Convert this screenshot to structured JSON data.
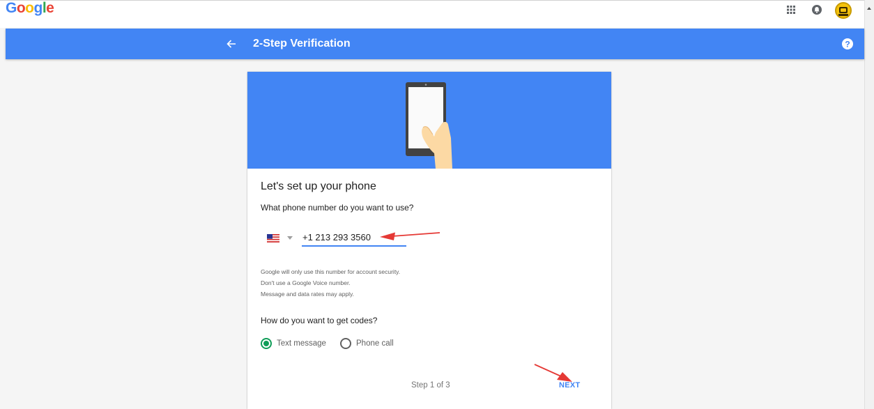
{
  "topbar": {
    "logo_letters": [
      "G",
      "o",
      "o",
      "g",
      "l",
      "e"
    ]
  },
  "header": {
    "title": "2-Step Verification"
  },
  "card": {
    "title": "Let's set up your phone",
    "phone_question": "What phone number do you want to use?",
    "phone_value": "+1 213 293 3560",
    "country": "US",
    "fine_print": [
      "Google will only use this number for account security.",
      "Don't use a Google Voice number.",
      "Message and data rates may apply."
    ],
    "codes_question": "How do you want to get codes?",
    "options": [
      {
        "label": "Text message",
        "selected": true
      },
      {
        "label": "Phone call",
        "selected": false
      }
    ],
    "step": "Step 1 of 3",
    "next_label": "NEXT"
  },
  "colors": {
    "header_blue": "#4285f4",
    "radio_green": "#0f9d58",
    "annotation_red": "#e53935"
  },
  "icons": [
    "back-arrow-icon",
    "help-icon",
    "apps-grid-icon",
    "notifications-icon",
    "flag-us-icon",
    "dropdown-caret-icon"
  ]
}
